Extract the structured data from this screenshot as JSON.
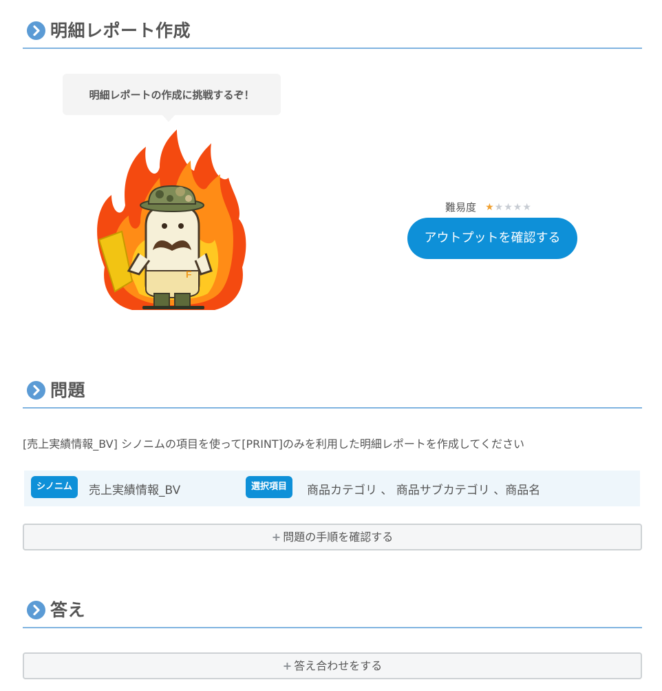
{
  "sections": {
    "report": {
      "title": "明細レポート作成"
    },
    "problem": {
      "title": "問題"
    },
    "answer": {
      "title": "答え"
    }
  },
  "bubble": {
    "text": "明細レポートの作成に挑戦するぞ！"
  },
  "difficulty": {
    "label": "難易度",
    "rating": 1,
    "max": 5,
    "stars_on": "★",
    "stars_off": "★★★★"
  },
  "output_button": {
    "label": "アウトプットを確認する"
  },
  "problem": {
    "description": "[売上実績情報_BV] シノニムの項目を使って[PRINT]のみを利用した明細レポートを作成してください",
    "synonym_tag": "シノニム",
    "synonym_value": "売上実績情報_BV",
    "select_tag": "選択項目",
    "select_value": "商品カテゴリ 、 商品サブカテゴリ 、商品名",
    "steps_button": "問題の手順を確認する"
  },
  "answer": {
    "check_button": "答え合わせをする"
  },
  "colors": {
    "accent": "#0e90d8",
    "divider": "#7fb3e0",
    "bullet": "#5b9bd5",
    "star_on": "#f0a030",
    "star_off": "#c7ccd3"
  },
  "icons": {
    "section_bullet": "chevron-right-circle-icon",
    "expand": "plus-icon",
    "mascot": "mascot-illustration"
  }
}
